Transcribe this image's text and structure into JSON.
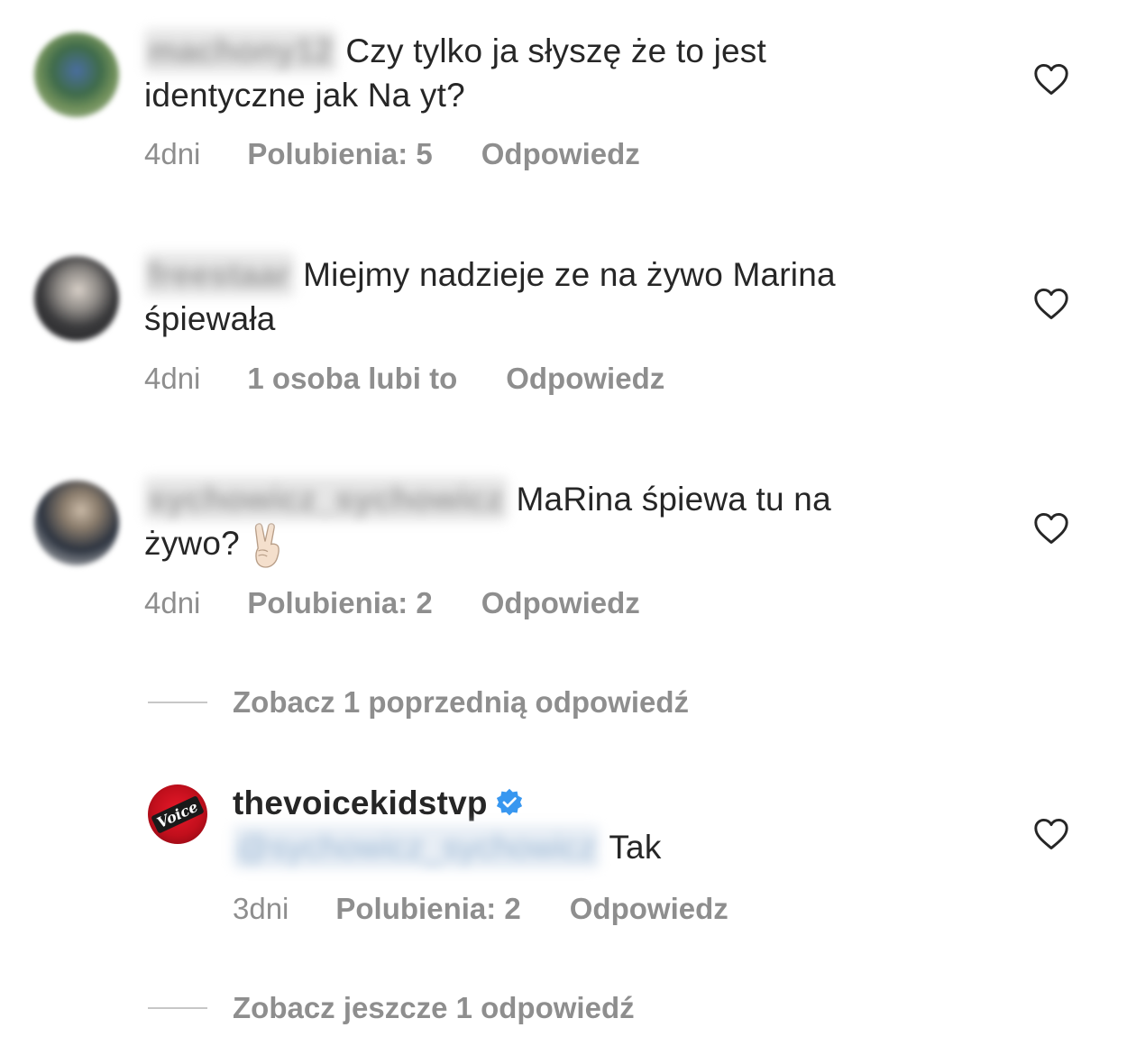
{
  "comments": [
    {
      "username": "machony12",
      "text_line1": "Czy tylko ja słyszę że to jest",
      "text_line2": "identyczne jak Na yt?",
      "time": "4dni",
      "likes": "Polubienia: 5",
      "reply": "Odpowiedz"
    },
    {
      "username": "freestaar",
      "text_line1": "Miejmy nadzieje ze na żywo Marina",
      "text_line2": "śpiewała",
      "time": "4dni",
      "likes": "1 osoba lubi to",
      "reply": "Odpowiedz"
    },
    {
      "username": "sychowicz_sychowicz",
      "text_line1": "MaRina śpiewa tu na",
      "text_line2": "żywo?",
      "emoji": "victory-hand",
      "time": "4dni",
      "likes": "Polubienia: 2",
      "reply": "Odpowiedz"
    }
  ],
  "view_previous_replies": "Zobacz 1 poprzednią odpowiedź",
  "reply_comment": {
    "username": "thevoicekidstvp",
    "verified": true,
    "mention": "@sychowicz_sychowicz",
    "text": "Tak",
    "time": "3dni",
    "likes": "Polubienia: 2",
    "reply": "Odpowiedz",
    "avatar_logo_text": "Voice"
  },
  "view_more_replies": "Zobacz jeszcze 1 odpowiedź",
  "colors": {
    "text": "#262626",
    "meta": "#8e8e8e",
    "verified": "#3897f0",
    "divider": "#c7c7c7"
  }
}
